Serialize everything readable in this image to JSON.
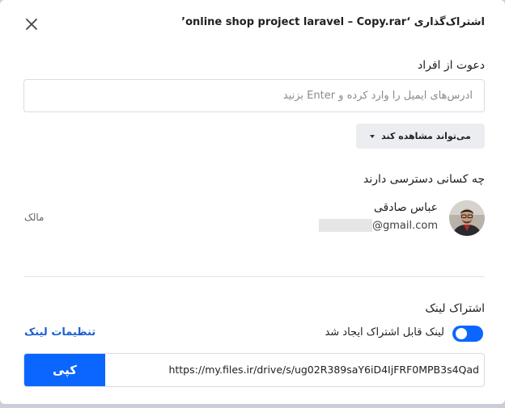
{
  "dialog": {
    "title": "اشتراک‌گذاری ‘online shop project laravel – Copy.rar’"
  },
  "invite": {
    "label": "دعوت از افراد",
    "placeholder": "آدرس‌های ایمیل را وارد کرده و Enter بزنید",
    "value": ""
  },
  "permission": {
    "selected": "می‌تواند مشاهده کند"
  },
  "access": {
    "label": "چه کسانی دسترسی دارند",
    "users": [
      {
        "name": "عباس صادقی",
        "email_domain": "@gmail.com",
        "role": "مالک"
      }
    ]
  },
  "link_share": {
    "label": "اشتراک لینک",
    "toggle_label": "لینک قابل اشتراک ایجاد شد",
    "toggle_on": true,
    "settings_label": "تنظیمات لینک",
    "url": "https://my.files.ir/drive/s/ug02R389saY6iD4IjFRF0MPB3s4Qad",
    "copy_label": "کپی"
  },
  "colors": {
    "accent": "#0b66ff",
    "link": "#1a5fd6"
  }
}
